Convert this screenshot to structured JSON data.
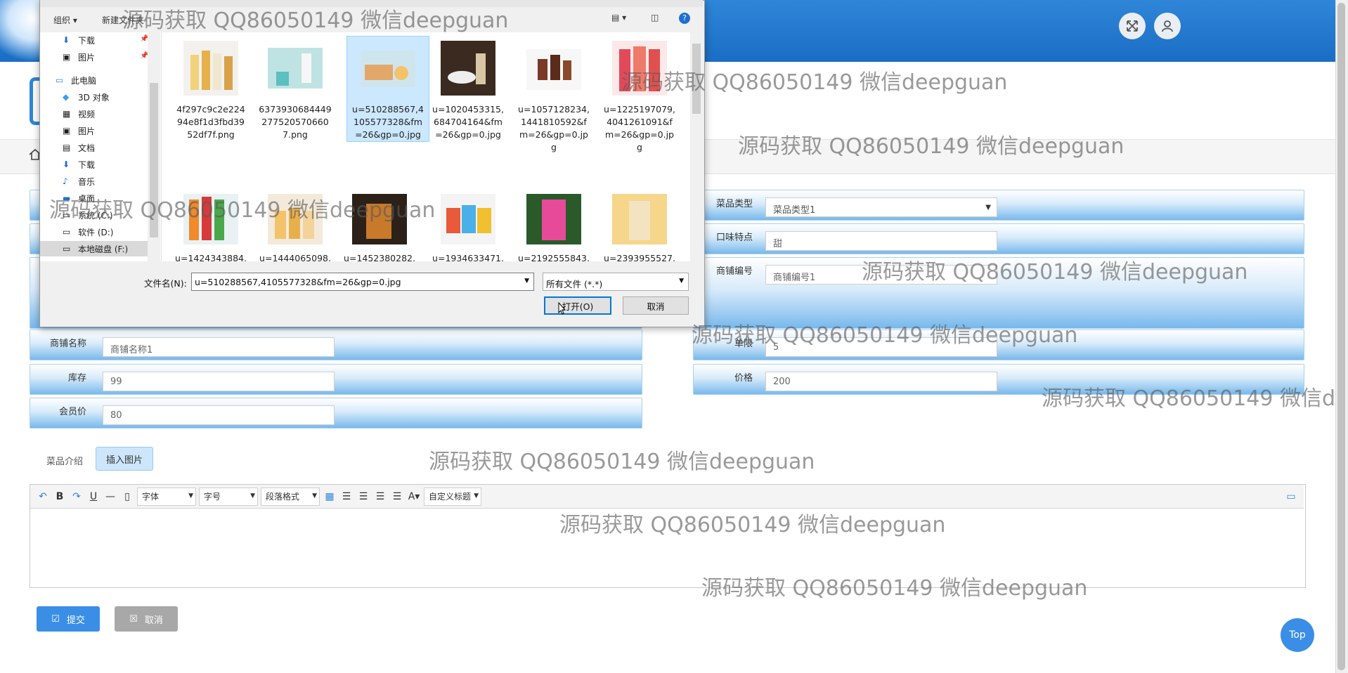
{
  "header": {
    "cloud": "cloud",
    "expand_icon": "expand-icon",
    "user_icon": "user-icon"
  },
  "form": {
    "dish_type_label": "菜品类型",
    "dish_type_value": "菜品类型1",
    "taste_label": "口味特点",
    "taste_value": "甜",
    "shop_no_label": "商铺编号",
    "shop_no_value": "商铺编号1",
    "shop_name_label": "商铺名称",
    "shop_name_value": "商铺名称1",
    "unit_label": "单限",
    "unit_value": "5",
    "stock_label": "库存",
    "stock_value": "99",
    "price_label": "价格",
    "price_value": "200",
    "member_price_label": "会员价",
    "member_price_value": "80",
    "intro_label": "菜品介绍",
    "insert_image_label": "插入图片"
  },
  "editor": {
    "font_label": "字体",
    "size_label": "字号",
    "para_label": "段落格式",
    "custom_label": "自定义标题"
  },
  "actions": {
    "submit_label": "提交",
    "cancel_label": "取消",
    "top_label": "Top"
  },
  "dialog": {
    "organize_label": "组织 ▾",
    "new_folder_label": "新建文件夹",
    "help_label": "?",
    "tree": [
      "下载",
      "图片",
      "此电脑",
      "3D 对象",
      "视频",
      "图片",
      "文档",
      "下载",
      "音乐",
      "桌面",
      "系统 (C:)",
      "软件 (D:)",
      "本地磁盘 (F:)"
    ],
    "files_row1": [
      [
        "4f297c9c2e224",
        "94e8f1d3fbd39",
        "52df7f.png"
      ],
      [
        "6373930684449",
        "277520570660",
        "7.png"
      ],
      [
        "u=510288567,4",
        "105577328&fm",
        "=26&gp=0.jpg"
      ],
      [
        "u=1020453315,",
        "684704164&fm",
        "=26&gp=0.jpg"
      ],
      [
        "u=1057128234,",
        "1441810592&f",
        "m=26&gp=0.jp",
        "g"
      ],
      [
        "u=1225197079,",
        "4041261091&f",
        "m=26&gp=0.jp",
        "g"
      ]
    ],
    "files_row2": [
      "u=1424343884,",
      "u=1444065098,",
      "u=1452380282,",
      "u=1934633471,",
      "u=2192555843,",
      "u=2393955527,"
    ],
    "filename_label": "文件名(N):",
    "filename_value": "u=510288567,4105577328&fm=26&gp=0.jpg",
    "filetype_value": "所有文件 (*.*)",
    "open_label": "打开(O)",
    "cancel_label": "取消"
  },
  "watermark": "源码获取 QQ86050149 微信deepguan",
  "colors": {
    "accent": "#3a8ee6",
    "header": "#1a6dc4",
    "row_gradient_end": "#78b9ec"
  }
}
